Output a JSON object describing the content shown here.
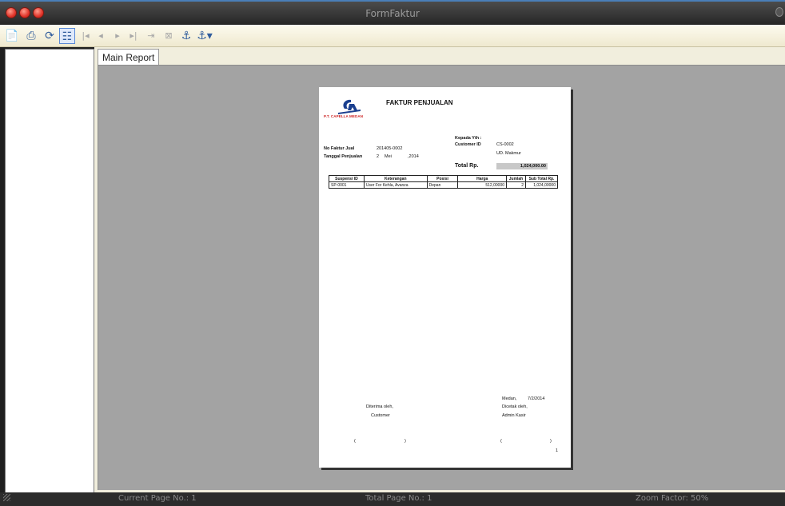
{
  "window": {
    "title": "FormFaktur"
  },
  "toolbar": {
    "buttons": [
      {
        "name": "export-icon",
        "glyph": "⎘"
      },
      {
        "name": "print-icon",
        "glyph": "⎙"
      },
      {
        "name": "refresh-icon",
        "glyph": "⟳"
      },
      {
        "name": "group-tree-icon",
        "glyph": "☷"
      },
      {
        "name": "first-page-icon",
        "glyph": "⏮"
      },
      {
        "name": "previous-page-icon",
        "glyph": "◀"
      },
      {
        "name": "next-page-icon",
        "glyph": "▶"
      },
      {
        "name": "last-page-icon",
        "glyph": "⏭"
      },
      {
        "name": "goto-page-icon",
        "glyph": "⇥"
      },
      {
        "name": "stop-icon",
        "glyph": "⊠"
      },
      {
        "name": "find-icon",
        "glyph": "⚲"
      },
      {
        "name": "zoom-icon",
        "glyph": "⚲"
      }
    ]
  },
  "tabs": {
    "main_report": "Main Report"
  },
  "report": {
    "company": "P.T. CAPELLA MEDAN",
    "title": "FAKTUR PENJUALAN",
    "kepada_label": "Kepada Yth :",
    "customer_id_label": "Customer ID",
    "customer_id": "CS-0002",
    "customer_name": "UD. Makmur",
    "no_faktur_label": "No Faktur Jual",
    "no_faktur": "201405-0002",
    "tanggal_label": "Tanggal Penjualan",
    "tanggal_day": "2",
    "tanggal_month": "Mei",
    "tanggal_year": ",2014",
    "total_label": "Total Rp.",
    "total_value": "1,024,000.00",
    "table": {
      "headers": [
        "Suspensi ID",
        "Keterangan",
        "Posisi",
        "Harga",
        "Jumlah",
        "Sub Total Rp."
      ],
      "rows": [
        [
          "SP-0001",
          "User For Kehla, Avanza",
          "Depan",
          "512,00000",
          "2",
          "1,024,00000"
        ]
      ]
    },
    "place_date": "Medan,",
    "print_date": "7/2/2014",
    "diterima_oleh": "Diterima oleh,",
    "customer_sign": "Customer",
    "dicetak_oleh": "Dicetak oleh,",
    "admin_sign": "Admin Kasir",
    "paren_open": "(",
    "paren_close": ")",
    "page_number": "1"
  },
  "status": {
    "current_page": "Current Page No.: 1",
    "total_page": "Total Page No.: 1",
    "zoom": "Zoom Factor: 50%"
  },
  "colors": {
    "accent": "#4a7fb8",
    "viewer_bg": "#a3a3a3",
    "logo_red": "#cc1f1f",
    "logo_blue": "#1b3f8f"
  }
}
